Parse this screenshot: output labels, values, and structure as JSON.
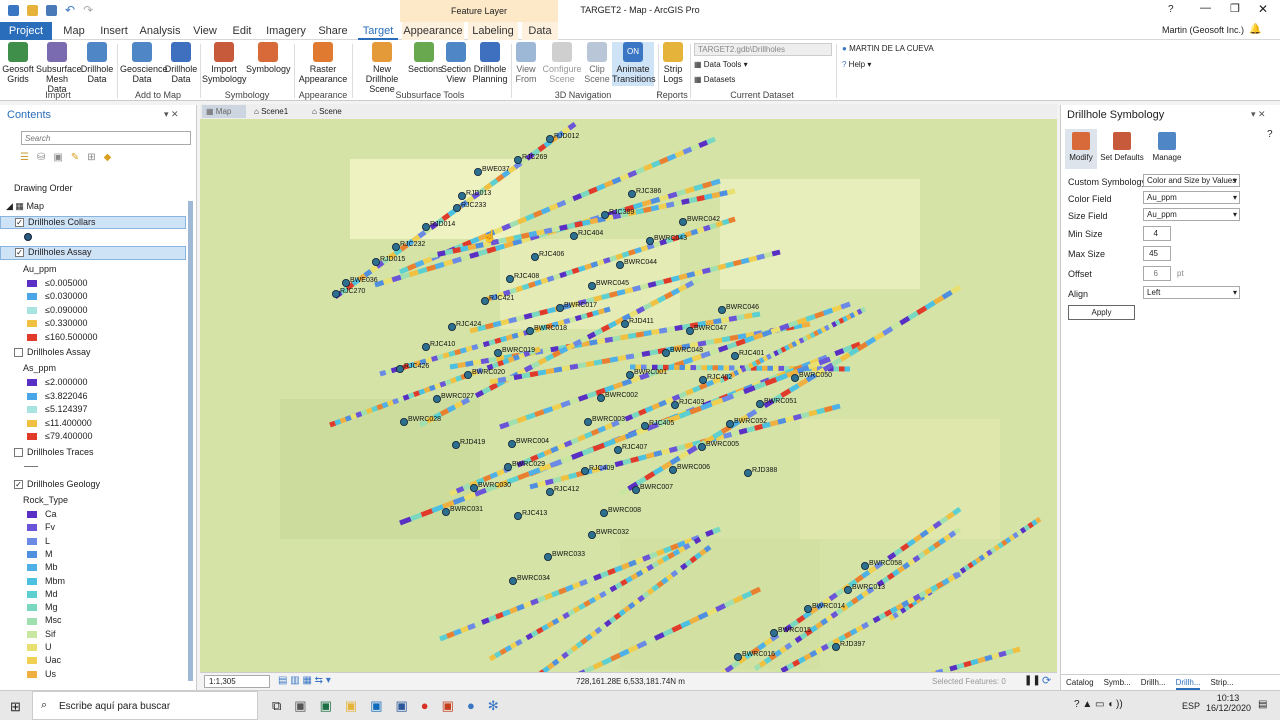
{
  "title": {
    "doc": "TARGET2 - Map - ArcGIS Pro",
    "feature_layer": "Feature Layer",
    "user": "Martin (Geosoft Inc.)",
    "help": "?"
  },
  "tabs": [
    "Project",
    "Map",
    "Insert",
    "Analysis",
    "View",
    "Edit",
    "Imagery",
    "Share",
    "Target",
    "Appearance",
    "Labeling",
    "Data"
  ],
  "ribbon": {
    "buttons": [
      "Geosoft Grids",
      "Subsurface Mesh Data",
      "Drillhole Data",
      "Geoscience Data",
      "Drillhole Data",
      "Import Symbology",
      "Symbology",
      "Raster Appearance",
      "New Drillhole Scene",
      "Sections",
      "Section View",
      "Drillhole Planning",
      "View From",
      "Configure Scene",
      "Clip Scene",
      "Animate Transitions",
      "Strip Logs"
    ],
    "on_label": "ON",
    "groups": [
      "Import",
      "Add to Map",
      "Symbology",
      "Appearance",
      "Subsurface Tools",
      "3D Navigation",
      "Reports",
      "Current Dataset"
    ],
    "dataset": "TARGET2.gdb\\Drillholes",
    "data_tools": "Data Tools",
    "datasets": "Datasets",
    "user_name": "MARTIN DE LA CUEVA",
    "help": "Help"
  },
  "contents": {
    "title": "Contents",
    "search_placeholder": "Search",
    "drawing_order": "Drawing Order",
    "map": "Map",
    "layers": [
      "Drillholes Collars",
      "Drillholes Assay",
      "Drillholes Assay",
      "Drillholes Traces",
      "Drillholes Geology"
    ],
    "au_field": "Au_ppm",
    "au_legend": [
      {
        "l": "≤0.005000",
        "c": "#5a2fc4"
      },
      {
        "l": "≤0.030000",
        "c": "#4aa6e6"
      },
      {
        "l": "≤0.090000",
        "c": "#a8e3e0"
      },
      {
        "l": "≤0.330000",
        "c": "#f0c040"
      },
      {
        "l": "≤160.500000",
        "c": "#e03a2a"
      }
    ],
    "as_field": "As_ppm",
    "as_legend": [
      {
        "l": "≤2.000000",
        "c": "#5a2fc4"
      },
      {
        "l": "≤3.822046",
        "c": "#4aa6e6"
      },
      {
        "l": "≤5.124397",
        "c": "#a8e3e0"
      },
      {
        "l": "≤11.400000",
        "c": "#f0c040"
      },
      {
        "l": "≤79.400000",
        "c": "#e03a2a"
      }
    ],
    "rock_field": "Rock_Type",
    "rock_legend": [
      {
        "l": "Ca",
        "c": "#5a2fc4"
      },
      {
        "l": "Fv",
        "c": "#6a55d8"
      },
      {
        "l": "L",
        "c": "#6a8ae6"
      },
      {
        "l": "M",
        "c": "#4f8fe0"
      },
      {
        "l": "Mb",
        "c": "#4fb0e8"
      },
      {
        "l": "Mbm",
        "c": "#4cc0e0"
      },
      {
        "l": "Md",
        "c": "#5cd0d0"
      },
      {
        "l": "Mg",
        "c": "#7ad8c0"
      },
      {
        "l": "Msc",
        "c": "#a0e0b0"
      },
      {
        "l": "Sif",
        "c": "#c8e6a0"
      },
      {
        "l": "U",
        "c": "#e8e070"
      },
      {
        "l": "Uac",
        "c": "#f0d050"
      },
      {
        "l": "Us",
        "c": "#f0b040"
      },
      {
        "l": "Usc",
        "c": "#e88030"
      }
    ]
  },
  "map": {
    "tabs": [
      "Map",
      "Scene1",
      "Scene"
    ],
    "scale": "1:1,305",
    "coords": "728,161.28E 6,533,181.74N m",
    "selected": "Selected Features: 0",
    "holes": [
      "RJD012",
      "BWE037",
      "RJC269",
      "RJD013",
      "RJC233",
      "RJC386",
      "RJD014",
      "RJC389",
      "BWRC042",
      "RJC232",
      "RJC404",
      "BWRC043",
      "RJD015",
      "RJC406",
      "BWRC044",
      "BWE036",
      "RJC270",
      "RJC408",
      "BWRC045",
      "RJC421",
      "BWRC017",
      "BWRC046",
      "RJD411",
      "RJC424",
      "BWRC018",
      "BWRC047",
      "RJC410",
      "BWRC019",
      "BWRC048",
      "RJC401",
      "RJC426",
      "BWRC020",
      "BWRC001",
      "BWRC050",
      "RJC402",
      "BWRC027",
      "BWRC002",
      "RJC403",
      "BWRC051",
      "BWRC028",
      "BWRC003",
      "RJC405",
      "BWRC052",
      "RJD419",
      "BWRC004",
      "RJC407",
      "BWRC005",
      "BWRC029",
      "RJC409",
      "BWRC006",
      "RJD388",
      "BWRC030",
      "RJC412",
      "BWRC007",
      "BWRC031",
      "RJC413",
      "BWRC008",
      "BWRC032",
      "BWRC033",
      "BWRC034",
      "BWRC058",
      "BWRC013",
      "BWRC014",
      "BWRC015",
      "BWRC016",
      "RJD397"
    ]
  },
  "symbology": {
    "title": "Drillhole Symbology",
    "modes": [
      "Modify",
      "Set Defaults",
      "Manage"
    ],
    "custom_label": "Custom Symbology",
    "custom_value": "Color and Size by Values",
    "color_field_label": "Color Field",
    "color_field": "Au_ppm",
    "size_field_label": "Size Field",
    "size_field": "Au_ppm",
    "min_size_label": "Min Size",
    "min_size": "4",
    "max_size_label": "Max Size",
    "max_size": "45",
    "offset_label": "Offset",
    "offset": "6",
    "offset_unit": "pt",
    "align_label": "Align",
    "align": "Left",
    "apply": "Apply",
    "bottom_tabs": [
      "Catalog",
      "Symb...",
      "Drillh...",
      "Drillh...",
      "Strip..."
    ]
  },
  "taskbar": {
    "search": "Escribe aquí para buscar",
    "lang": "ESP",
    "time": "10:13",
    "date": "16/12/2020"
  }
}
